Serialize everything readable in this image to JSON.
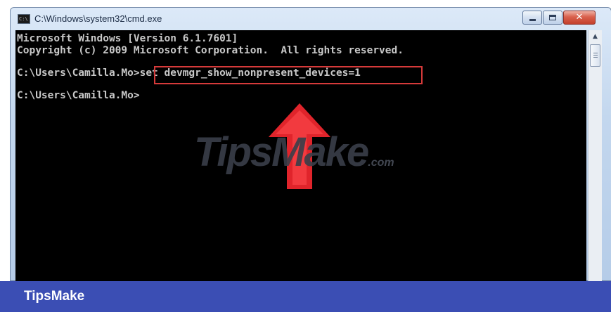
{
  "window": {
    "title": "C:\\Windows\\system32\\cmd.exe",
    "icon_text": "C:\\",
    "controls": {
      "minimize": "minimize-icon",
      "maximize": "maximize-icon",
      "close": "✕"
    }
  },
  "console": {
    "lines": [
      "Microsoft Windows [Version 6.1.7601]",
      "Copyright (c) 2009 Microsoft Corporation.  All rights reserved.",
      "C:\\Users\\Camilla.Mo>set devmgr_show_nonpresent_devices=1",
      "C:\\Users\\Camilla.Mo>"
    ],
    "highlighted_command": "set devmgr_show_nonpresent_devices=1",
    "text_color": "#c8c8c8",
    "background": "#000000"
  },
  "annotations": {
    "highlight_color": "#d63a3a",
    "arrow_color": "#e0242b",
    "arrow_icon": "up-arrow-icon"
  },
  "watermark": {
    "text": "TipsMake",
    "suffix": ".com"
  },
  "footer": {
    "brand": "TipsMake",
    "color": "#3b4eb4"
  }
}
